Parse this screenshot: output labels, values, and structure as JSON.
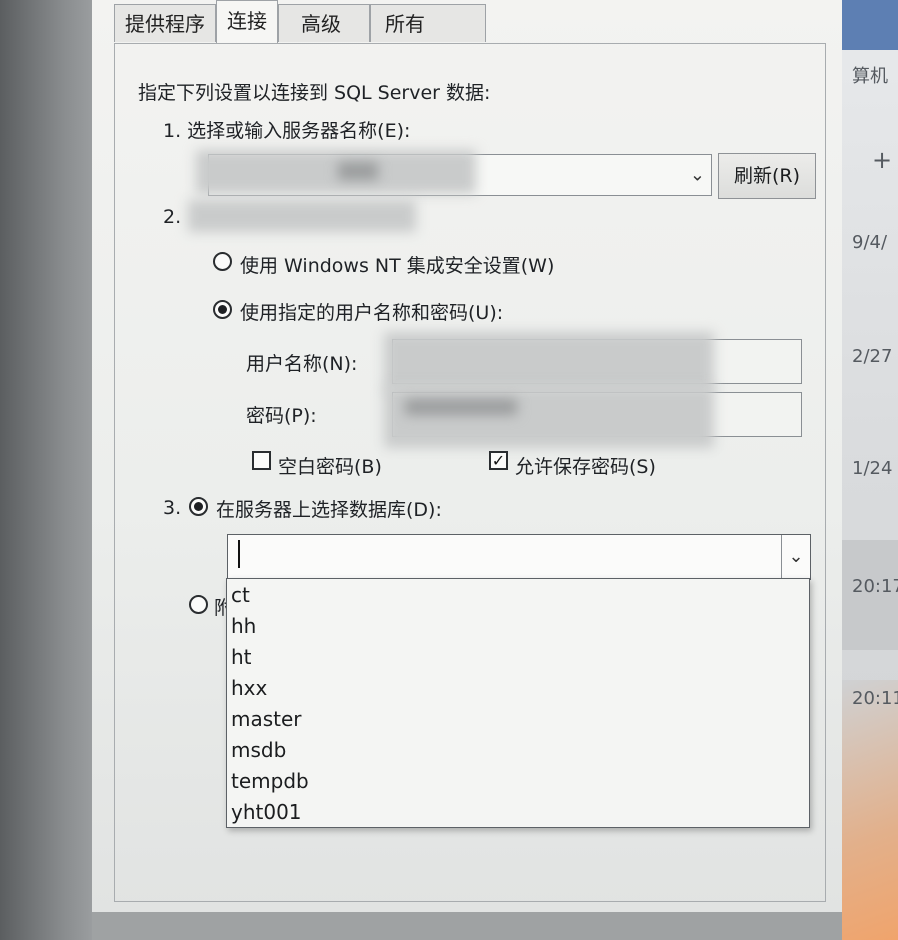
{
  "tabs": [
    "提供程序",
    "连接",
    "高级",
    "所有"
  ],
  "intro": "指定下列设置以连接到 SQL Server 数据:",
  "step1": {
    "label": "1. 选择或输入服务器名称(E):",
    "refresh_button": "刷新(R)",
    "server_value": ""
  },
  "step2": {
    "label": "2.",
    "radio_windows": "使用 Windows NT 集成安全设置(W)",
    "radio_specific": "使用指定的用户名称和密码(U):",
    "username_label": "用户名称(N):",
    "password_label": "密码(P):",
    "blank_password": "空白密码(B)",
    "allow_save": "允许保存密码(S)"
  },
  "step3": {
    "number": "3.",
    "radio_db": "在服务器上选择数据库(D):",
    "db_value": "",
    "radio_partial": "附"
  },
  "dropdown": {
    "options": [
      "ct",
      "hh",
      "ht",
      "hxx",
      "master",
      "msdb",
      "tempdb",
      "yht001"
    ]
  },
  "background": {
    "right_text": [
      "算机",
      "+",
      "9/4/",
      "2/27",
      "1/24",
      "20:17",
      "20:11"
    ]
  },
  "icons": {
    "chevron": "chevron-down-icon",
    "check": "checkmark-icon"
  }
}
